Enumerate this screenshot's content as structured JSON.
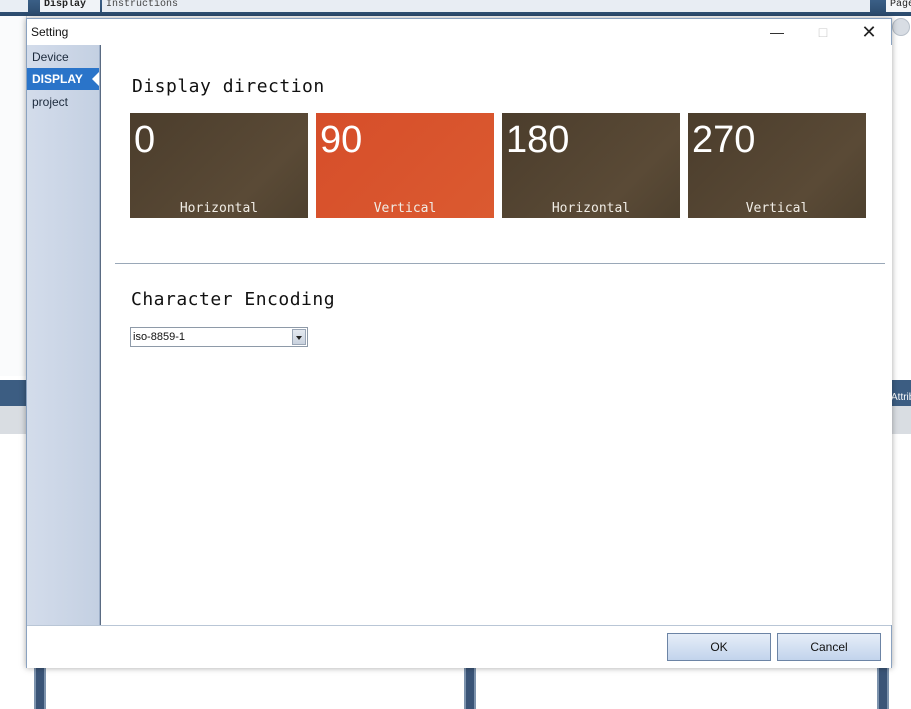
{
  "background": {
    "tab_left": "",
    "tab_display": "Display",
    "tab_instructions": "Instructions",
    "tab_right": "Page",
    "right_panel_label": "Attrib"
  },
  "dialog": {
    "title": "Setting",
    "window_buttons": {
      "minimize": "—",
      "maximize": "□",
      "close": "✕"
    }
  },
  "sidebar": {
    "items": [
      {
        "label": "Device",
        "active": false
      },
      {
        "label": "DISPLAY",
        "active": true
      },
      {
        "label": "project",
        "active": false
      }
    ]
  },
  "display_direction": {
    "title": "Display direction",
    "options": [
      {
        "value": "0",
        "label": "Horizontal",
        "selected": false
      },
      {
        "value": "90",
        "label": "Vertical",
        "selected": true
      },
      {
        "value": "180",
        "label": "Horizontal",
        "selected": false
      },
      {
        "value": "270",
        "label": "Vertical",
        "selected": false
      }
    ]
  },
  "character_encoding": {
    "title": "Character Encoding",
    "selected": "iso-8859-1"
  },
  "footer": {
    "ok_label": "OK",
    "cancel_label": "Cancel"
  },
  "colors": {
    "tile_default": "#4b3d2c",
    "tile_selected": "#d64e2a",
    "sidebar_active": "#2a74c9"
  }
}
